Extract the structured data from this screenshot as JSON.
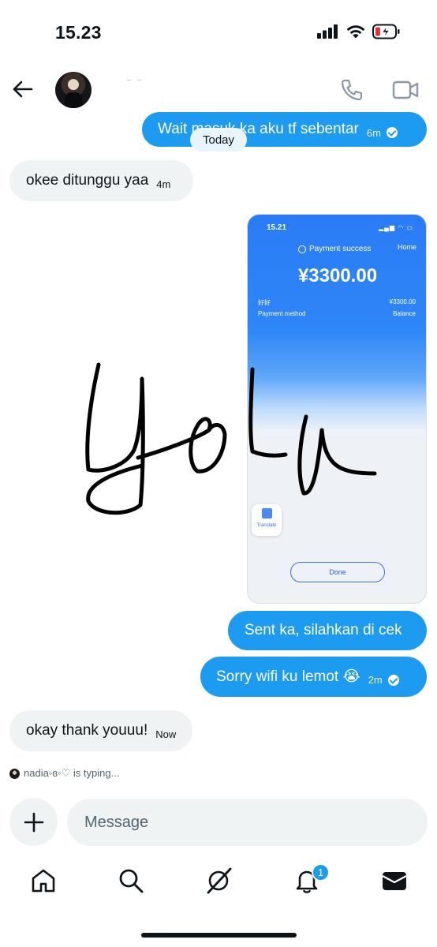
{
  "status_bar": {
    "time": "15.23",
    "battery_icon": "battery-charging-low-icon"
  },
  "header": {
    "name": "⁻ ⁻",
    "avatar": "profile-avatar"
  },
  "conversation": {
    "date_divider": "Today",
    "messages": [
      {
        "direction": "out",
        "text": "Wait masuk ka aku tf sebentar",
        "time": "6m",
        "read": true
      },
      {
        "direction": "in",
        "text": "okee ditunggu yaa",
        "time": "4m"
      },
      {
        "direction": "out",
        "type": "image"
      },
      {
        "direction": "out",
        "text": "Sent ka, silahkan di cek",
        "time": ""
      },
      {
        "direction": "out",
        "text": "Sorry wifi ku lemot 😭",
        "time": "2m",
        "read": true
      },
      {
        "direction": "in",
        "text": "okay thank youuu!",
        "time": "Now"
      }
    ],
    "shared_image": {
      "time": "15.21",
      "title": "Payment success",
      "home": "Home",
      "amount": "¥3300.00",
      "left_label": "好好",
      "right_value": "¥3300.00",
      "method_label": "Payment method",
      "method_value": "Balance",
      "translate_label": "Translate",
      "done_label": "Done",
      "handwriting": "Yola"
    },
    "typing_indicator": "nadia◦ɞ◦♡ is typing..."
  },
  "composer": {
    "placeholder": "Message"
  },
  "tab_bar": {
    "notifications_badge": "1"
  },
  "colors": {
    "accent": "#1d9bf0",
    "incoming_bubble": "#eff3f4",
    "text": "#0f1419"
  }
}
